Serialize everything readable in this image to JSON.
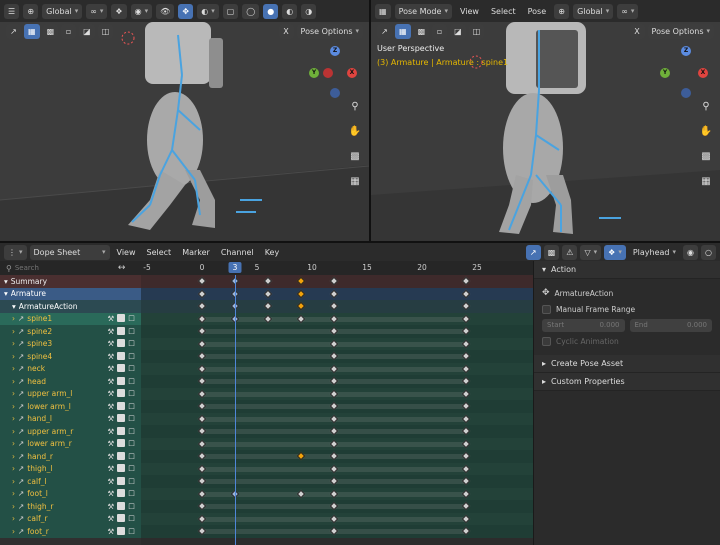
{
  "left_viewport": {
    "orientation": "Global",
    "options": "Pose Options",
    "x_label": "X"
  },
  "right_viewport": {
    "mode": "Pose Mode",
    "menus": [
      "View",
      "Select",
      "Pose"
    ],
    "orientation": "Global",
    "options": "Pose Options",
    "x_label": "X",
    "perspective": "User Perspective",
    "context": "(3) Armature | Armature : spine1"
  },
  "gizmo": {
    "x": "X",
    "y": "Y",
    "z": "Z"
  },
  "dopesheet": {
    "editor_label": "Dope Sheet",
    "menus": [
      "View",
      "Select",
      "Marker",
      "Channel",
      "Key"
    ],
    "playhead_label": "Playhead",
    "search_placeholder": "Search",
    "current_frame": "3",
    "ticks": [
      "-5",
      "0",
      "5",
      "10",
      "15",
      "20",
      "25"
    ],
    "channels": [
      {
        "name": "Summary",
        "type": "summary"
      },
      {
        "name": "Armature",
        "type": "object"
      },
      {
        "name": "ArmatureAction",
        "type": "action"
      },
      {
        "name": "spine1",
        "type": "group"
      },
      {
        "name": "spine2",
        "type": "group"
      },
      {
        "name": "spine3",
        "type": "group"
      },
      {
        "name": "spine4",
        "type": "group"
      },
      {
        "name": "neck",
        "type": "group"
      },
      {
        "name": "head",
        "type": "group"
      },
      {
        "name": "upper arm_l",
        "type": "group"
      },
      {
        "name": "lower arm_l",
        "type": "group"
      },
      {
        "name": "hand_l",
        "type": "group"
      },
      {
        "name": "upper arm_r",
        "type": "group"
      },
      {
        "name": "lower arm_r",
        "type": "group"
      },
      {
        "name": "hand_r",
        "type": "group"
      },
      {
        "name": "thigh_l",
        "type": "group"
      },
      {
        "name": "calf_l",
        "type": "group"
      },
      {
        "name": "foot_l",
        "type": "group"
      },
      {
        "name": "thigh_r",
        "type": "group"
      },
      {
        "name": "calf_r",
        "type": "group"
      },
      {
        "name": "foot_r",
        "type": "group"
      }
    ]
  },
  "sidebar": {
    "action_panel": "Action",
    "action_name": "ArmatureAction",
    "manual_frame_range": "Manual Frame Range",
    "start_label": "Start",
    "start_value": "0.000",
    "end_label": "End",
    "end_value": "0.000",
    "cyclic": "Cyclic Animation",
    "create_pose_asset": "Create Pose Asset",
    "custom_properties": "Custom Properties"
  },
  "colors": {
    "accent": "#4772b3",
    "selected_key": "#f2a20b",
    "group_text": "#f0c040"
  }
}
